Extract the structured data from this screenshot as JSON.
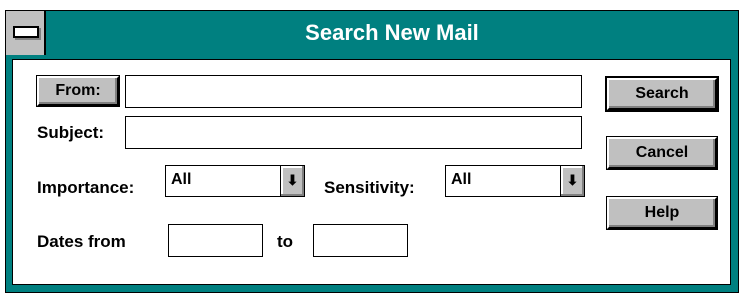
{
  "window": {
    "title": "Search New Mail"
  },
  "fields": {
    "from_label": "From:",
    "from_value": "",
    "subject_label": "Subject:",
    "subject_value": "",
    "importance_label": "Importance:",
    "importance_value": "All",
    "sensitivity_label": "Sensitivity:",
    "sensitivity_value": "All",
    "dates_from_label": "Dates from",
    "dates_from_value": "",
    "dates_to_label": "to",
    "dates_to_value": ""
  },
  "buttons": {
    "search": "Search",
    "cancel": "Cancel",
    "help": "Help"
  },
  "icons": {
    "system_menu": "system-menu-icon",
    "dropdown": "dropdown-arrow-icon"
  },
  "colors": {
    "title_bar": "#008080",
    "face": "#c0c0c0"
  }
}
